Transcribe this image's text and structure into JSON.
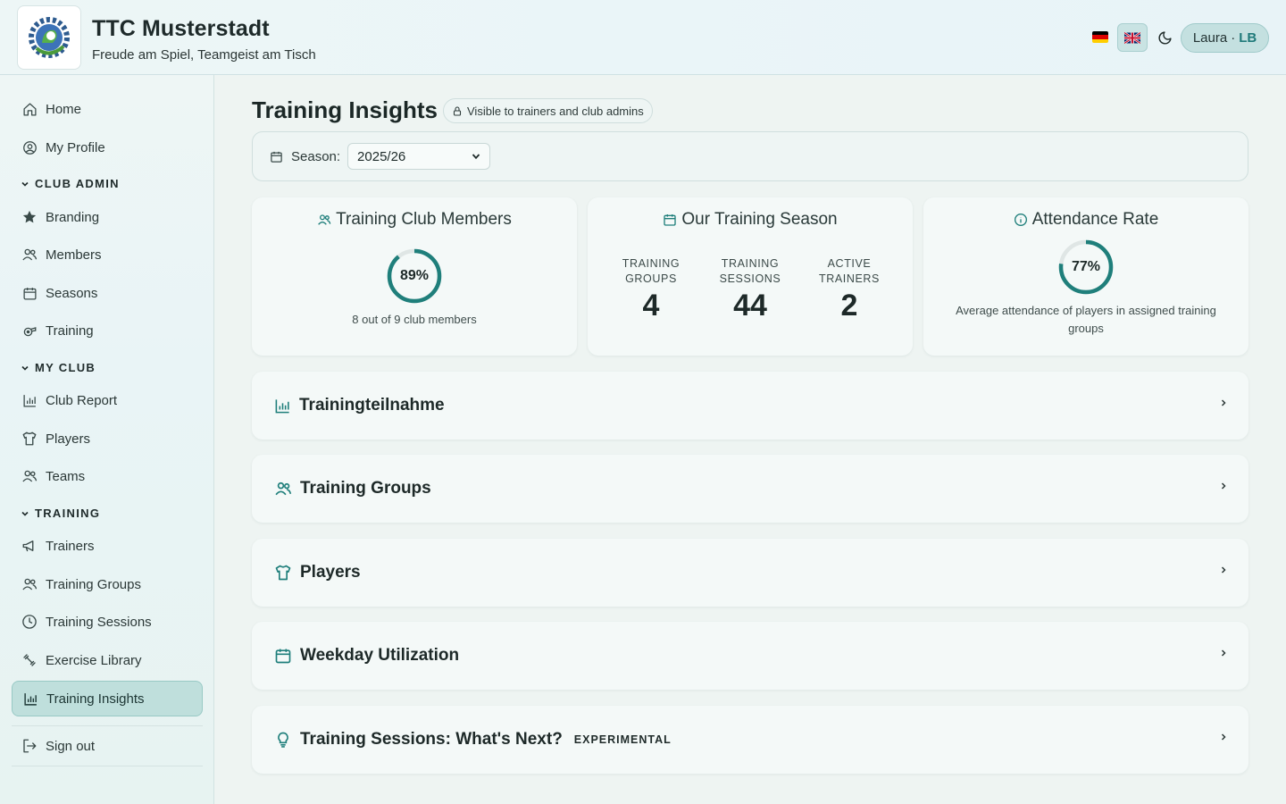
{
  "header": {
    "club_name": "TTC Musterstadt",
    "slogan": "Freude am Spiel, Teamgeist am Tisch",
    "user_name": "Laura",
    "user_separator": "·",
    "user_initials": "LB",
    "logo_icon": "club-logo-icon",
    "language_de": "german-flag-icon",
    "language_en": "uk-flag-icon",
    "theme_toggle": "moon-icon"
  },
  "sidebar": {
    "home": "Home",
    "profile": "My Profile",
    "section_club_admin": "CLUB ADMIN",
    "branding": "Branding",
    "members": "Members",
    "seasons": "Seasons",
    "training": "Training",
    "section_my_club": "MY CLUB",
    "club_report": "Club Report",
    "players": "Players",
    "teams": "Teams",
    "section_training": "TRAINING",
    "trainers": "Trainers",
    "training_groups": "Training Groups",
    "training_sessions": "Training Sessions",
    "exercise_library": "Exercise Library",
    "training_insights": "Training Insights",
    "sign_out": "Sign out"
  },
  "main": {
    "title": "Training Insights",
    "visibility": "Visible to trainers and club admins",
    "season_label": "Season:",
    "season_value": "2025/26",
    "cards": {
      "members_title": "Training Club Members",
      "members_percent": 89,
      "members_percent_label": "89%",
      "members_sub": "8 out of 9 club members",
      "season_title": "Our Training Season",
      "stat1_label_1": "TRAINING",
      "stat1_label_2": "GROUPS",
      "stat1_value": "4",
      "stat2_label_1": "TRAINING",
      "stat2_label_2": "SESSIONS",
      "stat2_value": "44",
      "stat3_label_1": "ACTIVE",
      "stat3_label_2": "TRAINERS",
      "stat3_value": "2",
      "attendance_title": "Attendance Rate",
      "attendance_percent": 77,
      "attendance_percent_label": "77%",
      "attendance_sub": "Average attendance of players in assigned training groups"
    },
    "sections": {
      "participation": "Trainingteilnahme",
      "groups": "Training Groups",
      "players": "Players",
      "weekday": "Weekday Utilization",
      "next": "Training Sessions: What's Next?",
      "next_badge": "EXPERIMENTAL"
    }
  },
  "colors": {
    "accent": "#1f7f7b",
    "ring_track": "#dfe6e5"
  }
}
